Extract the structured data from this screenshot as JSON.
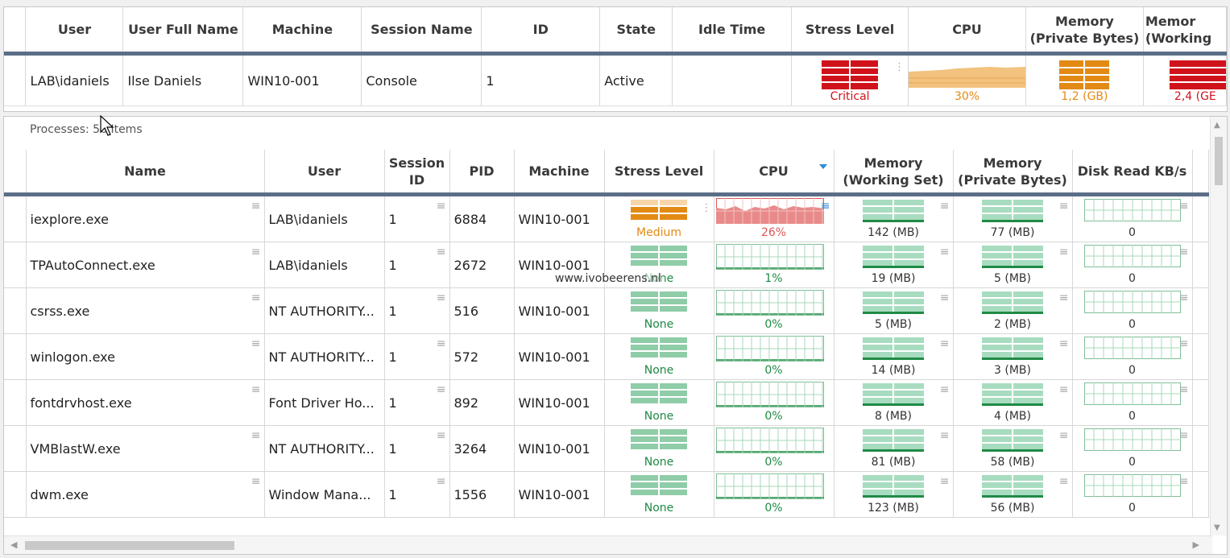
{
  "sessions": {
    "columns": [
      "User",
      "User Full Name",
      "Machine",
      "Session Name",
      "ID",
      "State",
      "Idle Time",
      "Stress Level",
      "CPU",
      "Memory (Private Bytes)",
      "Memory (Working"
    ],
    "row": {
      "user": "LAB\\idaniels",
      "full_name": "Ilse Daniels",
      "machine": "WIN10-001",
      "session_name": "Console",
      "id": "1",
      "state": "Active",
      "idle_time": "",
      "stress_level": "Critical",
      "cpu": "30%",
      "mem_private": "1,2 (GB)",
      "mem_working": "2,4 (GE"
    }
  },
  "processes": {
    "label": "Processes: 56 Items",
    "columns": [
      "Name",
      "User",
      "Session ID",
      "PID",
      "Machine",
      "Stress Level",
      "CPU",
      "Memory (Working Set)",
      "Memory (Private Bytes)",
      "Disk Read KB/s"
    ],
    "rows": [
      {
        "name": "iexplore.exe",
        "user": "LAB\\idaniels",
        "session": "1",
        "pid": "6884",
        "machine": "WIN10-001",
        "stress": "Medium",
        "cpu": "26%",
        "ws": "142 (MB)",
        "pb": "77 (MB)",
        "disk": "0"
      },
      {
        "name": "TPAutoConnect.exe",
        "user": "LAB\\idaniels",
        "session": "1",
        "pid": "2672",
        "machine": "WIN10-001",
        "stress": "None",
        "cpu": "1%",
        "ws": "19 (MB)",
        "pb": "5 (MB)",
        "disk": "0"
      },
      {
        "name": "csrss.exe",
        "user": "NT AUTHORITY...",
        "session": "1",
        "pid": "516",
        "machine": "WIN10-001",
        "stress": "None",
        "cpu": "0%",
        "ws": "5 (MB)",
        "pb": "2 (MB)",
        "disk": "0"
      },
      {
        "name": "winlogon.exe",
        "user": "NT AUTHORITY...",
        "session": "1",
        "pid": "572",
        "machine": "WIN10-001",
        "stress": "None",
        "cpu": "0%",
        "ws": "14 (MB)",
        "pb": "3 (MB)",
        "disk": "0"
      },
      {
        "name": "fontdrvhost.exe",
        "user": "Font Driver Ho...",
        "session": "1",
        "pid": "892",
        "machine": "WIN10-001",
        "stress": "None",
        "cpu": "0%",
        "ws": "8 (MB)",
        "pb": "4 (MB)",
        "disk": "0"
      },
      {
        "name": "VMBlastW.exe",
        "user": "NT AUTHORITY...",
        "session": "1",
        "pid": "3264",
        "machine": "WIN10-001",
        "stress": "None",
        "cpu": "0%",
        "ws": "81 (MB)",
        "pb": "58 (MB)",
        "disk": "0"
      },
      {
        "name": "dwm.exe",
        "user": "Window Mana...",
        "session": "1",
        "pid": "1556",
        "machine": "WIN10-001",
        "stress": "None",
        "cpu": "0%",
        "ws": "123 (MB)",
        "pb": "56 (MB)",
        "disk": "0"
      }
    ]
  },
  "watermark": "www.ivobeerens.nl",
  "colors": {
    "critical": "#d0131b",
    "warning": "#e38a14",
    "ok": "#8fcca8",
    "okDark": "#1f8a45",
    "header_rule": "#5c6e87",
    "cpu_high": "#e05555"
  }
}
